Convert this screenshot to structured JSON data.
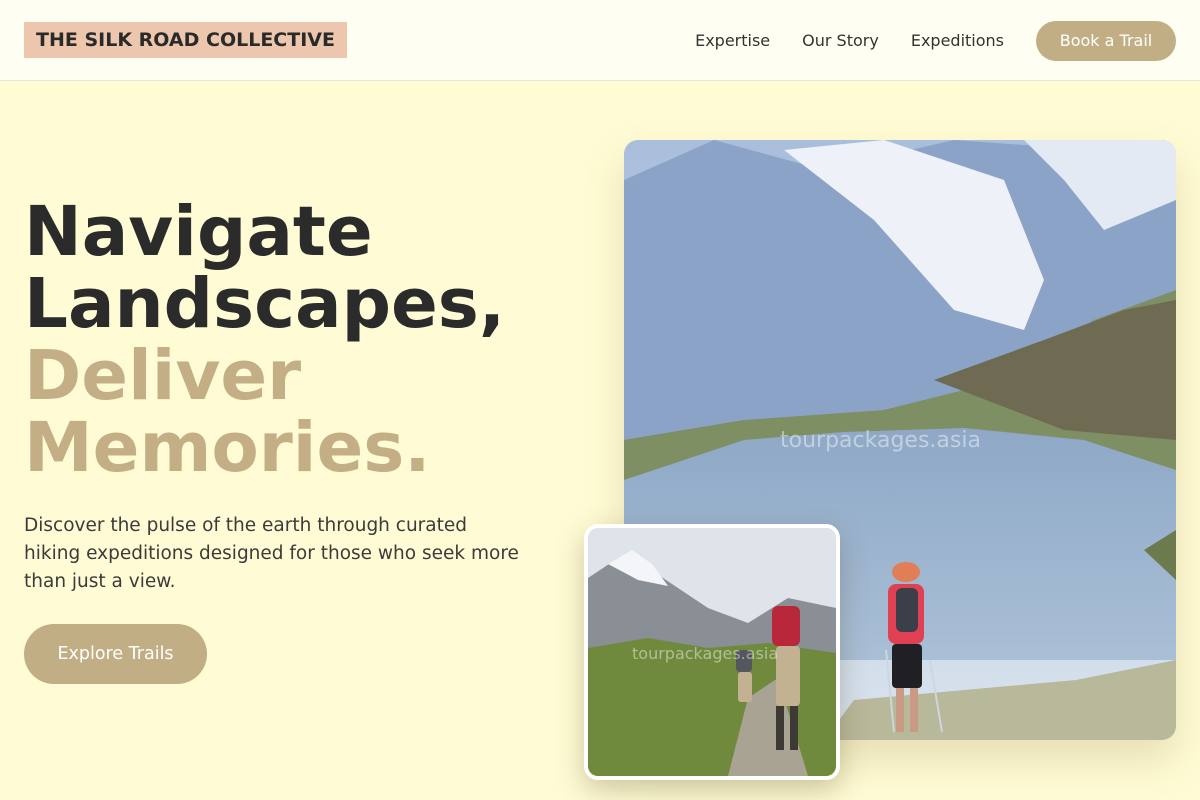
{
  "header": {
    "brand": "THE SILK ROAD COLLECTIVE",
    "nav": [
      "Expertise",
      "Our Story",
      "Expeditions"
    ],
    "cta": "Book a Trail"
  },
  "hero": {
    "headline_lines": [
      "Navigate",
      "Landscapes,"
    ],
    "accent_lines": [
      "Deliver",
      "Memories."
    ],
    "subtitle": "Discover the pulse of the earth through curated hiking expeditions designed for those who seek more than just a view.",
    "button": "Explore Trails"
  },
  "images": {
    "main_watermark": "tourpackages.asia",
    "small_watermark": "tourpackages.asia"
  },
  "colors": {
    "background": "#fffbd4",
    "accent": "#c2ae84",
    "brand_badge": "#ecc7ae",
    "text": "#2b2b2b"
  }
}
